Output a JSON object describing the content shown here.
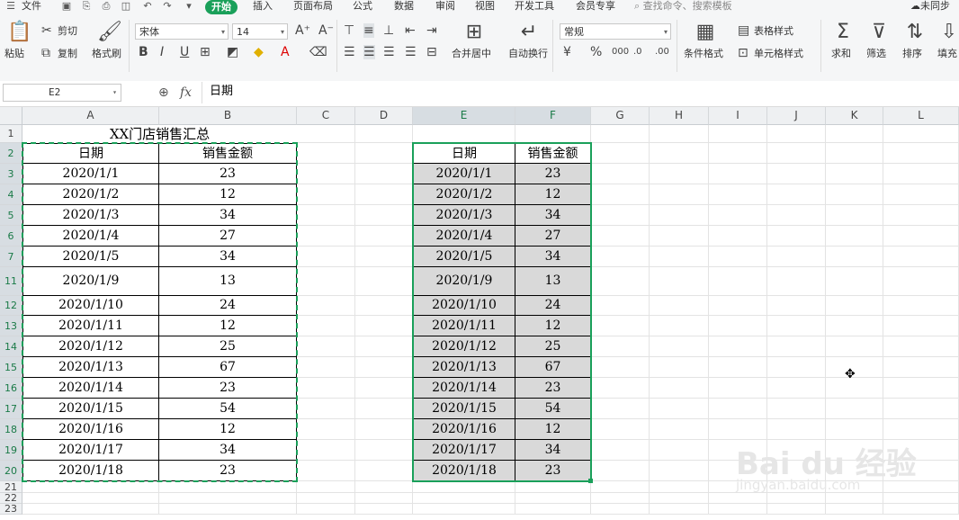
{
  "menu": {
    "items": [
      "文件",
      "开始",
      "插入",
      "页面布局",
      "公式",
      "数据",
      "审阅",
      "视图",
      "开发工具",
      "会员专享"
    ],
    "active_index": 1,
    "search_placeholder": "查找命令、搜索模板",
    "sync_label": "未同步"
  },
  "ribbon": {
    "paste": "粘贴",
    "cut": "剪切",
    "copy": "复制",
    "format_painter": "格式刷",
    "font_name": "宋体",
    "font_size": "14",
    "merge_center": "合并居中",
    "wrap_text": "自动换行",
    "number_format": "常规",
    "conditional_format": "条件格式",
    "table_style": "表格样式",
    "cell_style": "单元格样式",
    "sum": "求和",
    "filter": "筛选",
    "sort": "排序",
    "fill": "填充"
  },
  "formula_bar": {
    "name_box": "E2",
    "fx_label": "fx",
    "content": "日期"
  },
  "sheet": {
    "columns": [
      "A",
      "B",
      "C",
      "D",
      "E",
      "F",
      "G",
      "H",
      "I",
      "J",
      "K",
      "L"
    ],
    "selected_columns": [
      "E",
      "F"
    ],
    "row_numbers": [
      "1",
      "2",
      "3",
      "4",
      "5",
      "6",
      "7",
      "11",
      "12",
      "13",
      "14",
      "15",
      "16",
      "17",
      "18",
      "19",
      "20",
      "21",
      "22",
      "23"
    ],
    "title": "XX门店销售汇总",
    "headers": [
      "日期",
      "销售金额"
    ],
    "rows": [
      [
        "2020/1/1",
        "23"
      ],
      [
        "2020/1/2",
        "12"
      ],
      [
        "2020/1/3",
        "34"
      ],
      [
        "2020/1/4",
        "27"
      ],
      [
        "2020/1/5",
        "34"
      ],
      [
        "2020/1/9",
        "13"
      ],
      [
        "2020/1/10",
        "24"
      ],
      [
        "2020/1/11",
        "12"
      ],
      [
        "2020/1/12",
        "25"
      ],
      [
        "2020/1/13",
        "67"
      ],
      [
        "2020/1/14",
        "23"
      ],
      [
        "2020/1/15",
        "54"
      ],
      [
        "2020/1/16",
        "12"
      ],
      [
        "2020/1/17",
        "34"
      ],
      [
        "2020/1/18",
        "23"
      ]
    ]
  },
  "watermark": {
    "logo_text": "Bai du 经验",
    "url_text": "jingyan.baidu.com"
  },
  "colors": {
    "accent": "#1aa05a",
    "selection_fill": "#d9d9d9"
  }
}
